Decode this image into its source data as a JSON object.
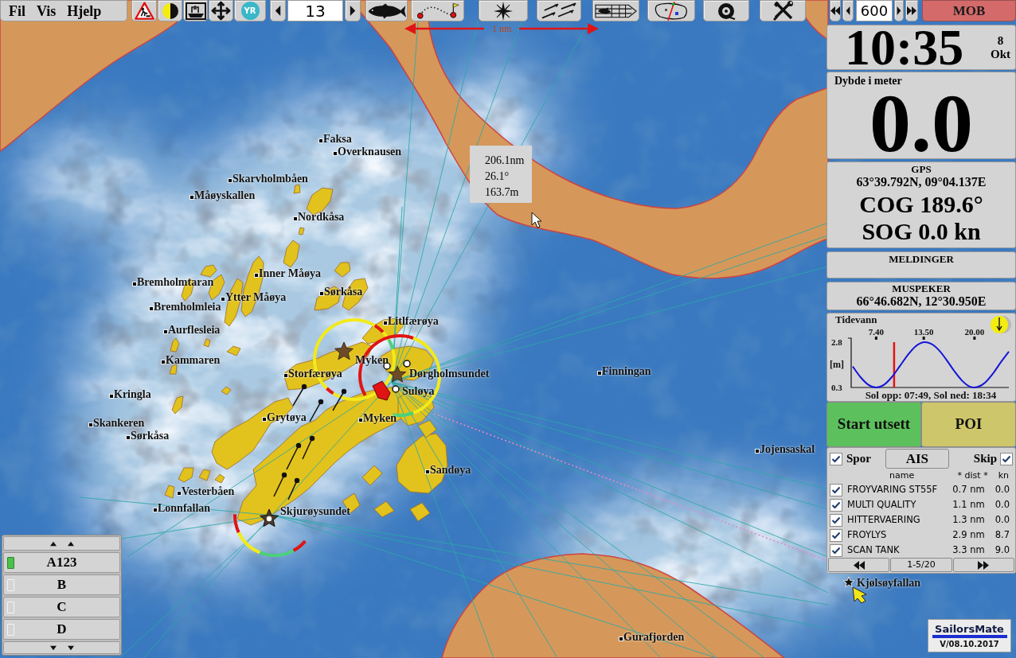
{
  "menu": [
    {
      "label": "Fil"
    },
    {
      "label": "Vis"
    },
    {
      "label": "Hjelp"
    }
  ],
  "toolbar": {
    "weather_button": "YR",
    "zoom_level": "13",
    "range": "600",
    "mob_button": "MOB"
  },
  "scale_bar": {
    "label": "1 nm"
  },
  "measure_tooltip": {
    "distance": "206.1nm",
    "bearing": "26.1°",
    "length": "163.7m"
  },
  "map_labels": [
    {
      "name": "Faksa",
      "kind": "point"
    },
    {
      "name": "Overknausen",
      "kind": "point"
    },
    {
      "name": "Skarvholmbåen",
      "kind": "point"
    },
    {
      "name": "Måøyskallen",
      "kind": "point"
    },
    {
      "name": "Nordkåsa",
      "kind": "point"
    },
    {
      "name": "Inner Måøya",
      "kind": "point"
    },
    {
      "name": "Bremholmtaran",
      "kind": "point"
    },
    {
      "name": "Ytter Måøya",
      "kind": "point"
    },
    {
      "name": "Sørkåsa",
      "kind": "point"
    },
    {
      "name": "Bremholmleia",
      "kind": "point"
    },
    {
      "name": "Litlfærøya",
      "kind": "point"
    },
    {
      "name": "Aurflesleia",
      "kind": "point"
    },
    {
      "name": "Kammaren",
      "kind": "point"
    },
    {
      "name": "Myken",
      "kind": "area"
    },
    {
      "name": "Storfærøya",
      "kind": "point"
    },
    {
      "name": "Dørgholmsundet",
      "kind": "area"
    },
    {
      "name": "Finningan",
      "kind": "point"
    },
    {
      "name": "Kringla",
      "kind": "point"
    },
    {
      "name": "Suløya",
      "kind": "area"
    },
    {
      "name": "Skankeren",
      "kind": "point"
    },
    {
      "name": "Grytøya",
      "kind": "point"
    },
    {
      "name": "Myken",
      "kind": "point"
    },
    {
      "name": "Sørkåsa",
      "kind": "point"
    },
    {
      "name": "Jojensaskal",
      "kind": "point"
    },
    {
      "name": "Sandøya",
      "kind": "point"
    },
    {
      "name": "Vesterbåen",
      "kind": "point"
    },
    {
      "name": "Lonnfallan",
      "kind": "point"
    },
    {
      "name": "Skjurøysundet",
      "kind": "area"
    },
    {
      "name": "Kjølsøyfallan",
      "kind": "area"
    },
    {
      "name": "Gurafjorden",
      "kind": "point"
    }
  ],
  "clock": {
    "time": "10:35",
    "day": "8",
    "month": "Okt"
  },
  "depth": {
    "title": "Dybde i meter",
    "value": "0.0"
  },
  "gps": {
    "title": "GPS",
    "position": "63°39.792N, 09°04.137E",
    "cog": "COG 189.6°",
    "sog": "SOG 0.0 kn"
  },
  "messages": {
    "title": "MELDINGER"
  },
  "cursor_position": {
    "title": "MUSPEKER",
    "position": "66°46.682N, 12°30.950E"
  },
  "tide": {
    "chart_data": {
      "type": "line",
      "title": "Tidevann",
      "ylabel": "[m]",
      "x": [
        4.4,
        5.4,
        6.4,
        7.4,
        8.4,
        9.4,
        10.4,
        11.4,
        12.4,
        13.4,
        14.4,
        15.4,
        16.4,
        17.4,
        18.4,
        19.4,
        20.4,
        21.4,
        22.4,
        23.4,
        24.4
      ],
      "values": [
        1.46,
        0.87,
        0.45,
        0.3,
        0.45,
        0.87,
        1.46,
        2.06,
        2.55,
        2.79,
        2.72,
        2.38,
        1.83,
        1.21,
        0.68,
        0.35,
        0.33,
        0.59,
        1.09,
        1.71,
        2.28
      ],
      "xlim": [
        4.2,
        24.4
      ],
      "ylim": [
        0.3,
        2.8
      ],
      "xticks": [
        {
          "value": 7.4,
          "label": "7.40"
        },
        {
          "value": 13.5,
          "label": "13.50"
        },
        {
          "value": 20,
          "label": "20.00"
        }
      ],
      "yticks": [
        {
          "value": 0.3,
          "label": "0.3"
        },
        {
          "value": 2.8,
          "label": "2.8"
        }
      ],
      "ref_lines": [
        {
          "axis": "x",
          "value": 9.7
        }
      ]
    },
    "sun": "Sol opp: 07:49, Sol ned: 18:34"
  },
  "actions": [
    {
      "label": "Start utsett",
      "kind": "start"
    },
    {
      "label": "POI",
      "kind": "poi"
    }
  ],
  "ais": {
    "track": {
      "label": "Spor",
      "checked": true
    },
    "tab": "AIS",
    "ships": {
      "label": "Skip",
      "checked": true
    },
    "columns": [
      "name",
      "* dist *",
      "kn"
    ],
    "rows": [
      {
        "name": "FROYVARING ST55F",
        "dist": "0.7 nm",
        "speed": "0.0",
        "checked": true
      },
      {
        "name": "MULTI QUALITY",
        "dist": "1.1 nm",
        "speed": "0.0",
        "checked": true
      },
      {
        "name": "HITTERVAERING",
        "dist": "1.3 nm",
        "speed": "0.0",
        "checked": true
      },
      {
        "name": "FROYLYS",
        "dist": "2.9 nm",
        "speed": "8.7",
        "checked": true
      },
      {
        "name": "SCAN TANK",
        "dist": "3.3 nm",
        "speed": "9.0",
        "checked": true
      }
    ],
    "pager": "1-5/20"
  },
  "layers": [
    {
      "label": "A123",
      "selected": true
    },
    {
      "label": "B",
      "selected": false
    },
    {
      "label": "C",
      "selected": false
    },
    {
      "label": "D",
      "selected": false
    }
  ],
  "logo": {
    "name": "SailorsMate",
    "version": "V/08.10.2017"
  }
}
